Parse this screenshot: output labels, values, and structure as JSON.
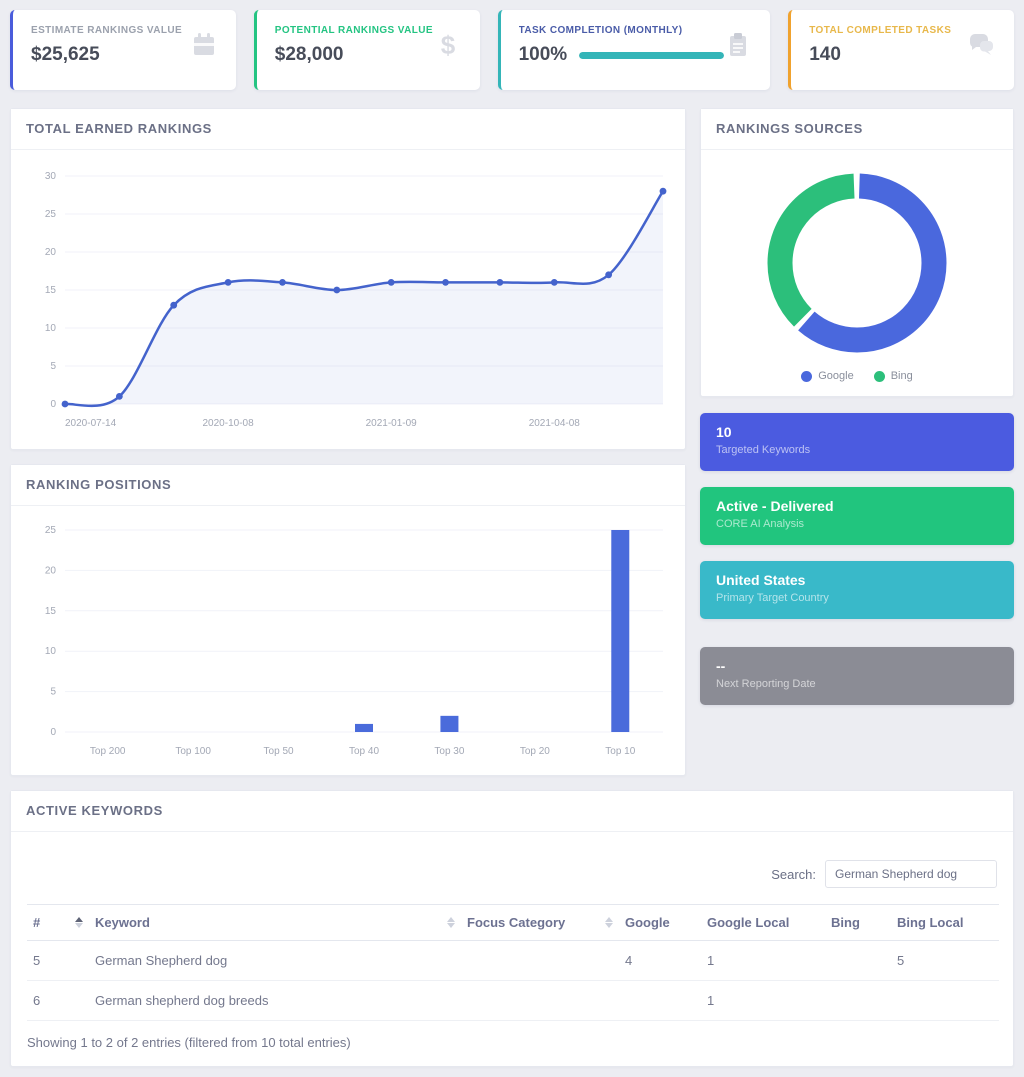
{
  "stat_cards": [
    {
      "label": "ESTIMATE RANKINGS VALUE",
      "value": "$25,625",
      "icon": "calendar-icon",
      "accent": "#4a5cdb",
      "label_color": "#9ba1ad"
    },
    {
      "label": "POTENTIAL RANKINGS VALUE",
      "value": "$28,000",
      "icon": "dollar-icon",
      "accent": "#24c482",
      "label_color": "#24c482"
    },
    {
      "label": "TASK COMPLETION (MONTHLY)",
      "value": "100%",
      "icon": "clipboard-icon",
      "accent": "#34b5b8",
      "label_color": "#4a5ca8",
      "progress_pct": 100,
      "progress_color": "#34b5b8"
    },
    {
      "label": "TOTAL COMPLETED TASKS",
      "value": "140",
      "icon": "chat-icon",
      "accent": "#f0a22e",
      "label_color": "#e8b84b"
    }
  ],
  "panels": {
    "total_earned_rankings": {
      "title": "TOTAL EARNED RANKINGS"
    },
    "ranking_positions": {
      "title": "RANKING POSITIONS"
    },
    "rankings_sources": {
      "title": "RANKINGS SOURCES"
    },
    "active_keywords": {
      "title": "ACTIVE KEYWORDS"
    }
  },
  "chart_data": [
    {
      "type": "line",
      "title": "TOTAL EARNED RANKINGS",
      "x": [
        "2020-07-14",
        "",
        "",
        "2020-10-08",
        "",
        "",
        "2021-01-09",
        "",
        "",
        "2021-04-08",
        "",
        ""
      ],
      "values": [
        0,
        1,
        13,
        16,
        16,
        15,
        16,
        16,
        16,
        16,
        17,
        28
      ],
      "ylim": [
        0,
        30
      ],
      "ytick": 5,
      "grid": true,
      "legend_position": "none",
      "color": "#4463cc",
      "area_fill": "rgba(74,99,204,0.07)"
    },
    {
      "type": "bar",
      "title": "RANKING POSITIONS",
      "categories": [
        "Top 200",
        "Top 100",
        "Top 50",
        "Top 40",
        "Top 30",
        "Top 20",
        "Top 10"
      ],
      "values": [
        0,
        0,
        0,
        1,
        2,
        0,
        25
      ],
      "ylim": [
        0,
        25
      ],
      "ytick": 5,
      "grid": true,
      "legend_position": "none",
      "color": "#4a6bdb"
    },
    {
      "type": "pie",
      "title": "RANKINGS SOURCES",
      "donut": true,
      "labels": [
        "Google",
        "Bing"
      ],
      "values": [
        62,
        38
      ],
      "colors": [
        "#4a68dd",
        "#2cbf7b"
      ],
      "legend_position": "bottom"
    }
  ],
  "info_cards": [
    {
      "title": "10",
      "subtitle": "Targeted Keywords",
      "bg": "#4b5be0"
    },
    {
      "title": "Active - Delivered",
      "subtitle": "CORE AI Analysis",
      "bg": "#21c57e"
    },
    {
      "title": "United States",
      "subtitle": "Primary Target Country",
      "bg": "#39b9c9"
    },
    {
      "title": "--",
      "subtitle": "Next Reporting Date",
      "bg": "#8b8c95"
    }
  ],
  "table": {
    "search_label": "Search:",
    "search_value": "German Shepherd dog",
    "columns": [
      {
        "label": "#",
        "sort": "asc"
      },
      {
        "label": "Keyword",
        "sort": "none"
      },
      {
        "label": "Focus Category",
        "sort": "none"
      },
      {
        "label": "Google",
        "sort": "hidden"
      },
      {
        "label": "Google Local",
        "sort": "hidden"
      },
      {
        "label": "Bing",
        "sort": "hidden"
      },
      {
        "label": "Bing Local",
        "sort": "hidden"
      }
    ],
    "rows": [
      {
        "num": "5",
        "keyword": "German Shepherd dog",
        "focus_category": "",
        "google": "4",
        "google_local": "1",
        "bing": "",
        "bing_local": "5"
      },
      {
        "num": "6",
        "keyword": "German shepherd dog breeds",
        "focus_category": "",
        "google": "",
        "google_local": "1",
        "bing": "",
        "bing_local": ""
      }
    ],
    "footer": "Showing 1 to 2 of 2 entries (filtered from 10 total entries)"
  }
}
